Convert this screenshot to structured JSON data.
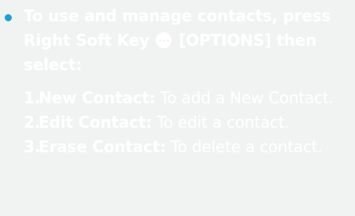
{
  "intro": {
    "text_before_icon": "To use and manage contacts, press Right Soft Key",
    "icon": "softkey-options-icon",
    "text_after_icon": "[OPTIONS] then select:"
  },
  "options": [
    {
      "number": "1.",
      "term": "New Contact:",
      "description": "To add a New Contact."
    },
    {
      "number": "2.",
      "term": "Edit Contact:",
      "description": "To edit a contact."
    },
    {
      "number": "3.",
      "term": "Erase Contact:",
      "description": "To delete a contact."
    }
  ],
  "colors": {
    "background": "#f1f3f2",
    "text": "#ffffff",
    "bullet": "#1a9fd7"
  }
}
